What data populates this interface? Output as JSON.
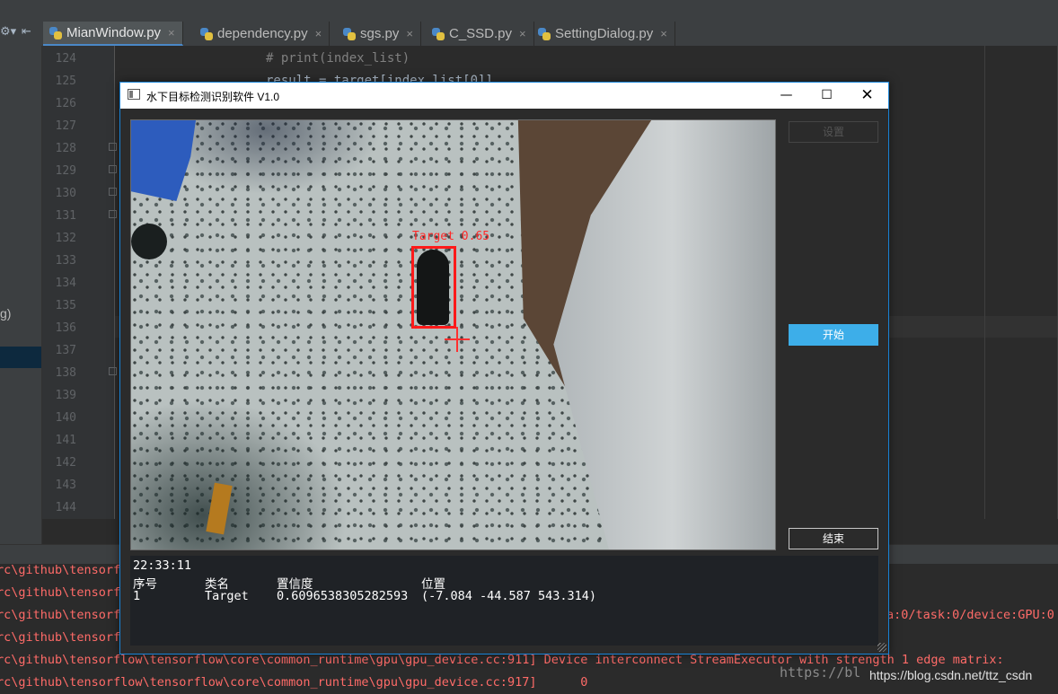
{
  "ide": {
    "tabs": [
      {
        "label": "MianWindow.py",
        "active": true
      },
      {
        "label": "dependency.py",
        "active": false
      },
      {
        "label": "sgs.py",
        "active": false
      },
      {
        "label": "C_SSD.py",
        "active": false
      },
      {
        "label": "SettingDialog.py",
        "active": false
      }
    ],
    "close_glyph": "×",
    "left_panel_text": "g)",
    "line_numbers": [
      "124",
      "125",
      "126",
      "127",
      "128",
      "129",
      "130",
      "131",
      "132",
      "133",
      "134",
      "135",
      "136",
      "137",
      "138",
      "139",
      "140",
      "141",
      "142",
      "143",
      "144"
    ],
    "code_lines": [
      {
        "text": "# print(index_list)",
        "kind": "comment"
      },
      {
        "text": "result = target[index_list[0]]",
        "kind": "normal"
      }
    ],
    "console_lines": [
      "rc\\github\\tensorf",
      "rc\\github\\tensorf",
      "rc\\github\\tensorf",
      "rc\\github\\tensorf",
      "rc\\github\\tensorflow\\tensorflow\\core\\common_runtime\\gpu\\gpu_device.cc:911] Device interconnect StreamExecutor with strength 1 edge matrix:",
      "rc\\github\\tensorflow\\tensorflow\\core\\common_runtime\\gpu\\gpu_device.cc:917]      0"
    ],
    "console_right_text": "a:0/task:0/device:GPU:0",
    "watermark": "https://bl",
    "watermark2": "https://blog.csdn.net/ttz_csdn"
  },
  "window": {
    "title": "水下目标检测识别软件 V1.0",
    "controls": {
      "minimize": "—",
      "maximize": "☐",
      "close": "✕"
    },
    "detection_label": "Target 0.65",
    "buttons": {
      "settings": "设置",
      "start": "开始",
      "end": "结束"
    },
    "output": {
      "time": "22:33:11",
      "headers": [
        "序号",
        "类名",
        "置信度",
        "位置"
      ],
      "rows": [
        [
          "1",
          "Target",
          "0.6096538305282593",
          "(-7.084  -44.587  543.314)"
        ]
      ]
    }
  },
  "colors": {
    "accent_blue": "#3daee9",
    "window_border": "#1883d7",
    "detection_red": "#ff1a1a",
    "console_error": "#ff6b68"
  }
}
